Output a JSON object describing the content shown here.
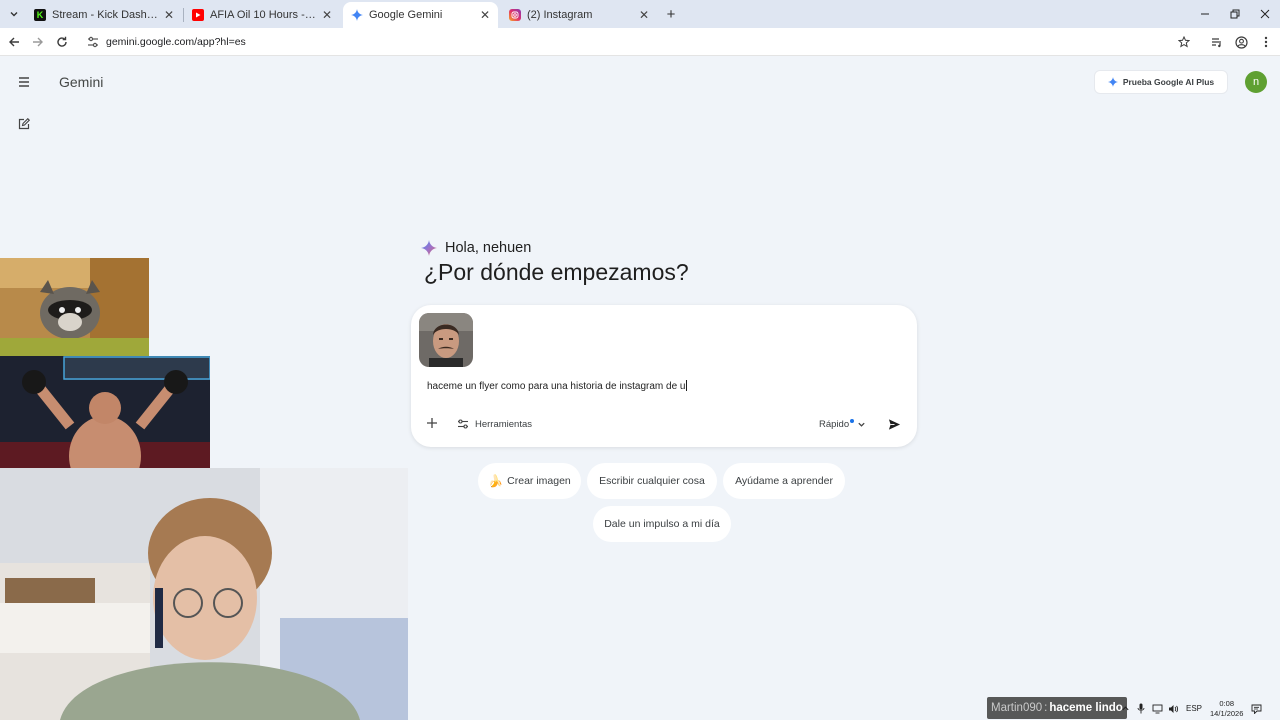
{
  "browser": {
    "tabs": [
      {
        "title": "Stream - Kick Dashboard",
        "icon": "kick-icon",
        "color": "#53fc18"
      },
      {
        "title": "AFIA Oil 10 Hours - YouTube",
        "icon": "youtube-icon",
        "color": "#ff0000"
      },
      {
        "title": "Google Gemini",
        "icon": "gemini-icon",
        "color": "#4285f4"
      },
      {
        "title": "(2) Instagram",
        "icon": "instagram-icon",
        "color": "#e1306c"
      }
    ],
    "url": "gemini.google.com/app?hl=es"
  },
  "app": {
    "name": "Gemini",
    "upgrade_label": "Prueba Google AI Plus",
    "avatar_initial": "n"
  },
  "greeting": {
    "hello": "Hola, nehuen",
    "question": "¿Por dónde empezamos?"
  },
  "composer": {
    "prompt_text": "haceme un flyer como para una historia de instagram de u",
    "tools_label": "Herramientas",
    "mode_label": "Rápido"
  },
  "suggestions": {
    "create_image": "Crear imagen",
    "create_image_emoji": "🍌",
    "write_anything": "Escribir cualquier cosa",
    "help_learn": "Ayúdame a aprender",
    "boost_day": "Dale un impulso a mi día"
  },
  "stream_overlay": {
    "chat_user": "Martin090",
    "chat_sep": ":",
    "chat_message": "haceme lindo"
  },
  "taskbar": {
    "language": "ESP",
    "time": "0:08",
    "date": "14/1/2026"
  },
  "colors": {
    "page_bg": "#f0f4f9",
    "avatar_bg": "#5fa032",
    "accent": "#1a73e8"
  }
}
